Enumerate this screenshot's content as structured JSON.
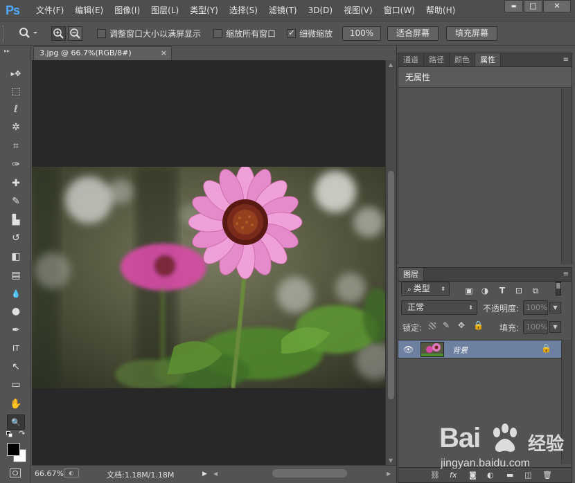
{
  "app": {
    "logo": "Ps",
    "menu": [
      "文件(F)",
      "编辑(E)",
      "图像(I)",
      "图层(L)",
      "类型(Y)",
      "选择(S)",
      "滤镜(T)",
      "3D(D)",
      "视图(V)",
      "窗口(W)",
      "帮助(H)"
    ],
    "window_controls": {
      "minimize": "▬",
      "restore": "□",
      "close": "✕"
    }
  },
  "options": {
    "resize_windows": "调整窗口大小以满屏显示",
    "zoom_all": "缩放所有窗口",
    "scrubby_zoom": "细微缩放",
    "btn_100": "100%",
    "btn_fit": "适合屏幕",
    "btn_fill": "填充屏幕",
    "resize_windows_checked": false,
    "zoom_all_checked": false,
    "scrubby_zoom_checked": true
  },
  "tools": [
    {
      "name": "move-tool-icon",
      "glyph": "▸✥"
    },
    {
      "name": "marquee-tool-icon",
      "glyph": "⬚"
    },
    {
      "name": "lasso-tool-icon",
      "glyph": "ℓ"
    },
    {
      "name": "magic-wand-tool-icon",
      "glyph": "✲"
    },
    {
      "name": "crop-tool-icon",
      "glyph": "⌗"
    },
    {
      "name": "eyedropper-tool-icon",
      "glyph": "✑"
    },
    {
      "name": "healing-brush-tool-icon",
      "glyph": "✚"
    },
    {
      "name": "brush-tool-icon",
      "glyph": "✎"
    },
    {
      "name": "clone-stamp-tool-icon",
      "glyph": "▙"
    },
    {
      "name": "history-brush-tool-icon",
      "glyph": "↺"
    },
    {
      "name": "eraser-tool-icon",
      "glyph": "◧"
    },
    {
      "name": "gradient-tool-icon",
      "glyph": "▤"
    },
    {
      "name": "blur-tool-icon",
      "glyph": "💧"
    },
    {
      "name": "dodge-tool-icon",
      "glyph": "●"
    },
    {
      "name": "pen-tool-icon",
      "glyph": "✒"
    },
    {
      "name": "type-tool-icon",
      "glyph": "IT"
    },
    {
      "name": "path-selection-tool-icon",
      "glyph": "↖"
    },
    {
      "name": "shape-tool-icon",
      "glyph": "▭"
    },
    {
      "name": "hand-tool-icon",
      "glyph": "✋"
    },
    {
      "name": "zoom-tool-icon",
      "glyph": "🔍"
    }
  ],
  "document": {
    "tab_title": "3.jpg @ 66.7%(RGB/8#)",
    "tab_close": "×"
  },
  "status": {
    "zoom": "66.67%",
    "doc_size": "文档:1.18M/1.18M",
    "arrow": "▶"
  },
  "properties_panel": {
    "tabs": [
      "通道",
      "路径",
      "颜色",
      "属性"
    ],
    "active_tab": "属性",
    "heading": "无属性"
  },
  "layers_panel": {
    "tab": "图层",
    "filter_type": "类型",
    "blend_mode": "正常",
    "opacity_label": "不透明度:",
    "opacity_value": "100%",
    "lock_label": "锁定:",
    "fill_label": "填充:",
    "fill_value": "100%",
    "layer_name": "背景"
  },
  "watermark": {
    "brand": "Bai  经验",
    "logo_text": "Bai",
    "cn": "经验",
    "url": "jingyan.baidu.com"
  },
  "colors": {
    "accent": "#4ea9ff",
    "layer_selected": "#6d80a0",
    "foreground": "#000000",
    "background": "#ffffff"
  }
}
